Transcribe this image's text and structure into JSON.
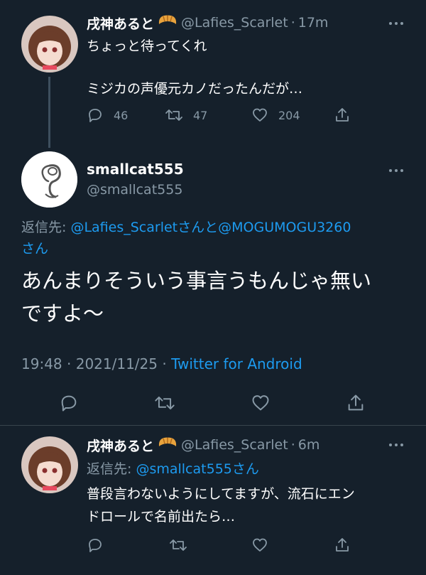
{
  "tweet1": {
    "name": "戌神あると",
    "badge_icon": "croissant-icon",
    "handle": "@Lafies_Scarlet",
    "time": "17m",
    "line1": "ちょっと待ってくれ",
    "line2": "ミジカの声優元カノだったんだが…",
    "replies": "46",
    "retweets": "47",
    "likes": "204"
  },
  "main_tweet": {
    "name": "smallcat555",
    "handle": "@smallcat555",
    "reply_prefix": "返信先: ",
    "reply_to_1": "@Lafies_Scarlet",
    "reply_and": "さんと",
    "reply_to_2": "@MOGUMOGU3260",
    "reply_suffix": "さん",
    "text_line1": "あんまりそういう事言うもんじゃ無い",
    "text_line2": "ですよ〜",
    "time": "19:48",
    "date": "2021/11/25",
    "source": "Twitter for Android"
  },
  "tweet3": {
    "name": "戌神あると",
    "handle": "@Lafies_Scarlet",
    "time": "6m",
    "reply_prefix": "返信先: ",
    "reply_to": "@smallcat555",
    "reply_suffix": "さん",
    "line1": "普段言わないようにしてますが、流石にエン",
    "line2": "ドロールで名前出たら…"
  },
  "colors": {
    "background": "#15202b",
    "muted": "#8899a6",
    "link": "#1d9bf0",
    "divider": "#38444d"
  }
}
